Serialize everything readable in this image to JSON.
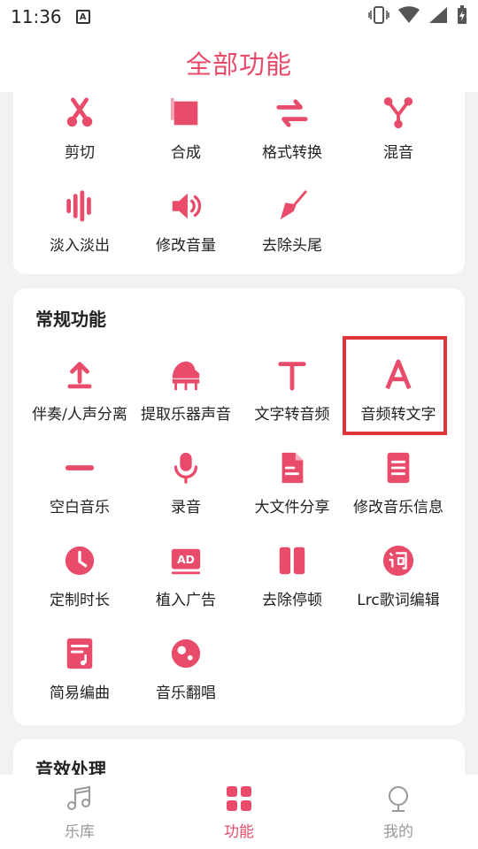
{
  "status_bar": {
    "time": "11:36",
    "badge": "A"
  },
  "header": {
    "title": "全部功能"
  },
  "card_top": {
    "items": [
      {
        "label": "剪切",
        "icon": "scissors-icon"
      },
      {
        "label": "合成",
        "icon": "merge-icon"
      },
      {
        "label": "格式转换",
        "icon": "convert-arrows-icon"
      },
      {
        "label": "混音",
        "icon": "mix-nodes-icon"
      },
      {
        "label": "淡入淡出",
        "icon": "waveform-icon"
      },
      {
        "label": "修改音量",
        "icon": "speaker-icon"
      },
      {
        "label": "去除头尾",
        "icon": "trowel-icon"
      }
    ]
  },
  "card_general": {
    "title": "常规功能",
    "items": [
      {
        "label": "伴奏/人声分离",
        "icon": "upload-icon"
      },
      {
        "label": "提取乐器声音",
        "icon": "piano-icon"
      },
      {
        "label": "文字转音频",
        "icon": "text-t-icon"
      },
      {
        "label": "音频转文字",
        "icon": "letter-a-icon"
      },
      {
        "label": "空白音乐",
        "icon": "minus-bar-icon"
      },
      {
        "label": "录音",
        "icon": "microphone-icon"
      },
      {
        "label": "大文件分享",
        "icon": "file-icon"
      },
      {
        "label": "修改音乐信息",
        "icon": "document-lines-icon"
      },
      {
        "label": "定制时长",
        "icon": "clock-icon"
      },
      {
        "label": "植入广告",
        "icon": "ad-icon"
      },
      {
        "label": "去除停顿",
        "icon": "pause-icon"
      },
      {
        "label": "Lrc歌词编辑",
        "icon": "lyrics-icon"
      },
      {
        "label": "简易编曲",
        "icon": "score-icon"
      },
      {
        "label": "音乐翻唱",
        "icon": "record-disc-icon"
      }
    ]
  },
  "card_effects": {
    "title": "音效处理"
  },
  "bottom_nav": {
    "items": [
      {
        "label": "乐库",
        "icon": "music-note-icon",
        "active": false
      },
      {
        "label": "功能",
        "icon": "grid-icon",
        "active": true
      },
      {
        "label": "我的",
        "icon": "profile-icon",
        "active": false
      }
    ]
  },
  "colors": {
    "accent": "#e94b6a",
    "highlight_border": "#e0353b",
    "inactive": "#999999"
  }
}
